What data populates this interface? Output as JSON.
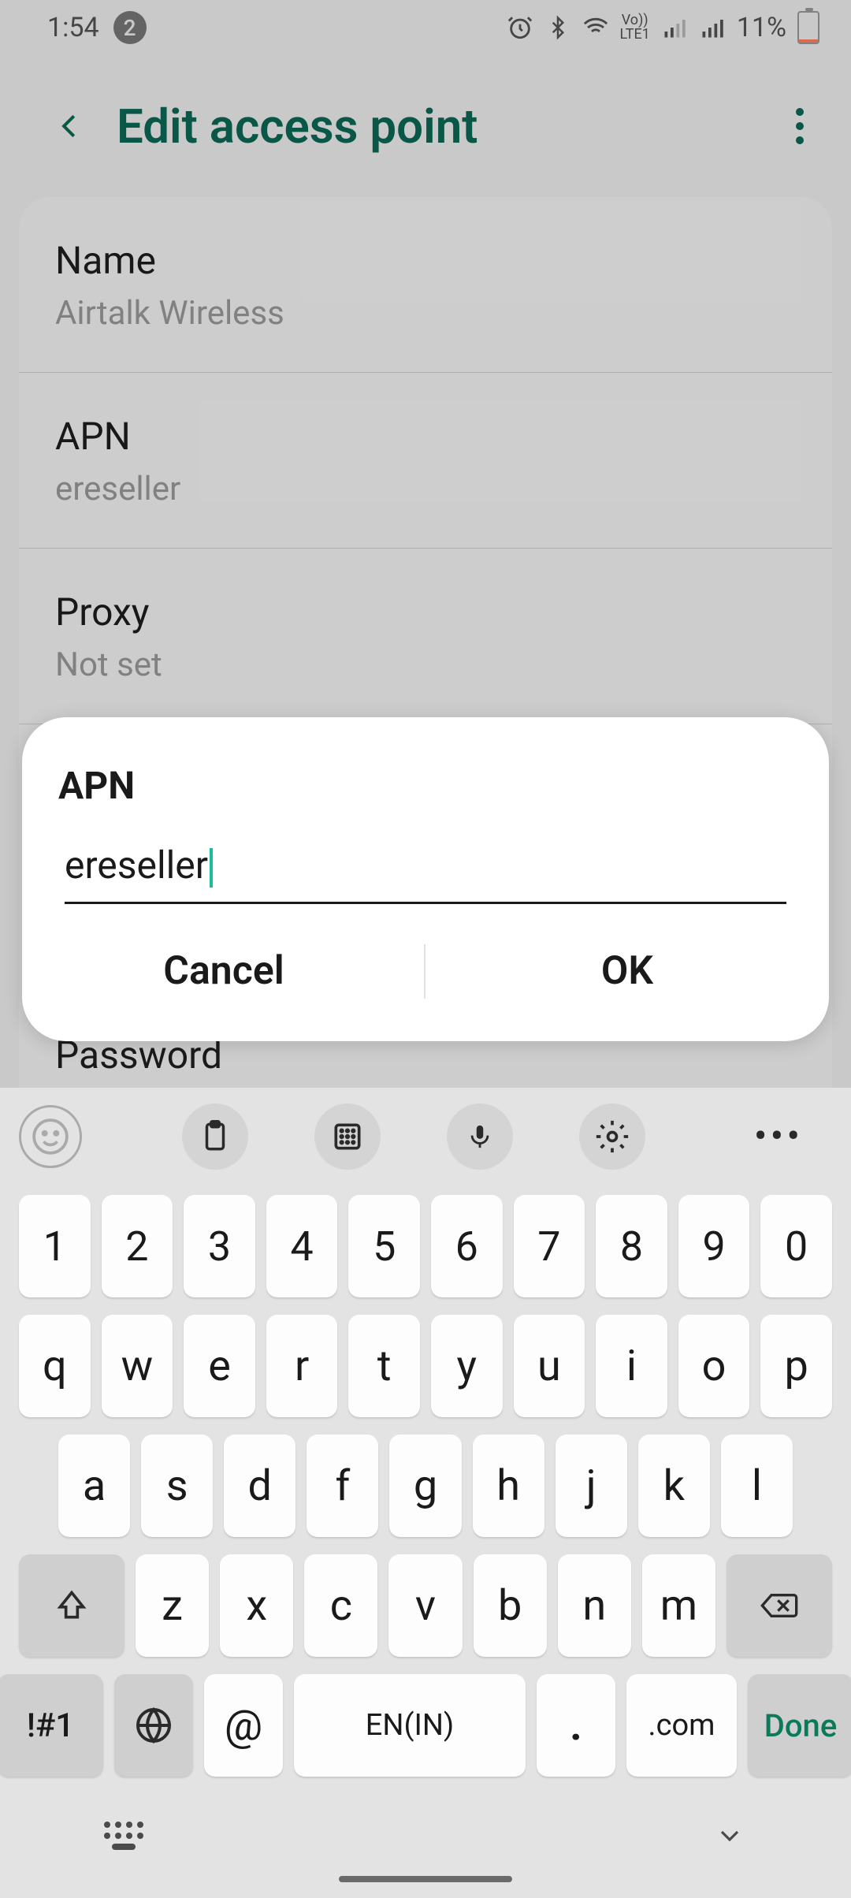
{
  "status_bar": {
    "time": "1:54",
    "notif_count": "2",
    "lte_label": "Vo))\nLTE1",
    "battery_pct": "11%"
  },
  "header": {
    "title": "Edit access point"
  },
  "settings": [
    {
      "label": "Name",
      "value": "Airtalk Wireless"
    },
    {
      "label": "APN",
      "value": "ereseller"
    },
    {
      "label": "Proxy",
      "value": "Not set"
    }
  ],
  "password_peek_label": "Password",
  "dialog": {
    "title": "APN",
    "input_value": "ereseller",
    "cancel_label": "Cancel",
    "ok_label": "OK"
  },
  "keyboard": {
    "row1": [
      "1",
      "2",
      "3",
      "4",
      "5",
      "6",
      "7",
      "8",
      "9",
      "0"
    ],
    "row2": [
      "q",
      "w",
      "e",
      "r",
      "t",
      "y",
      "u",
      "i",
      "o",
      "p"
    ],
    "row3": [
      "a",
      "s",
      "d",
      "f",
      "g",
      "h",
      "j",
      "k",
      "l"
    ],
    "row4": [
      "z",
      "x",
      "c",
      "v",
      "b",
      "n",
      "m"
    ],
    "sym_label": "!#1",
    "at_label": "@",
    "space_label": "EN(IN)",
    "dot_label": ".",
    "com_label": ".com",
    "done_label": "Done"
  }
}
